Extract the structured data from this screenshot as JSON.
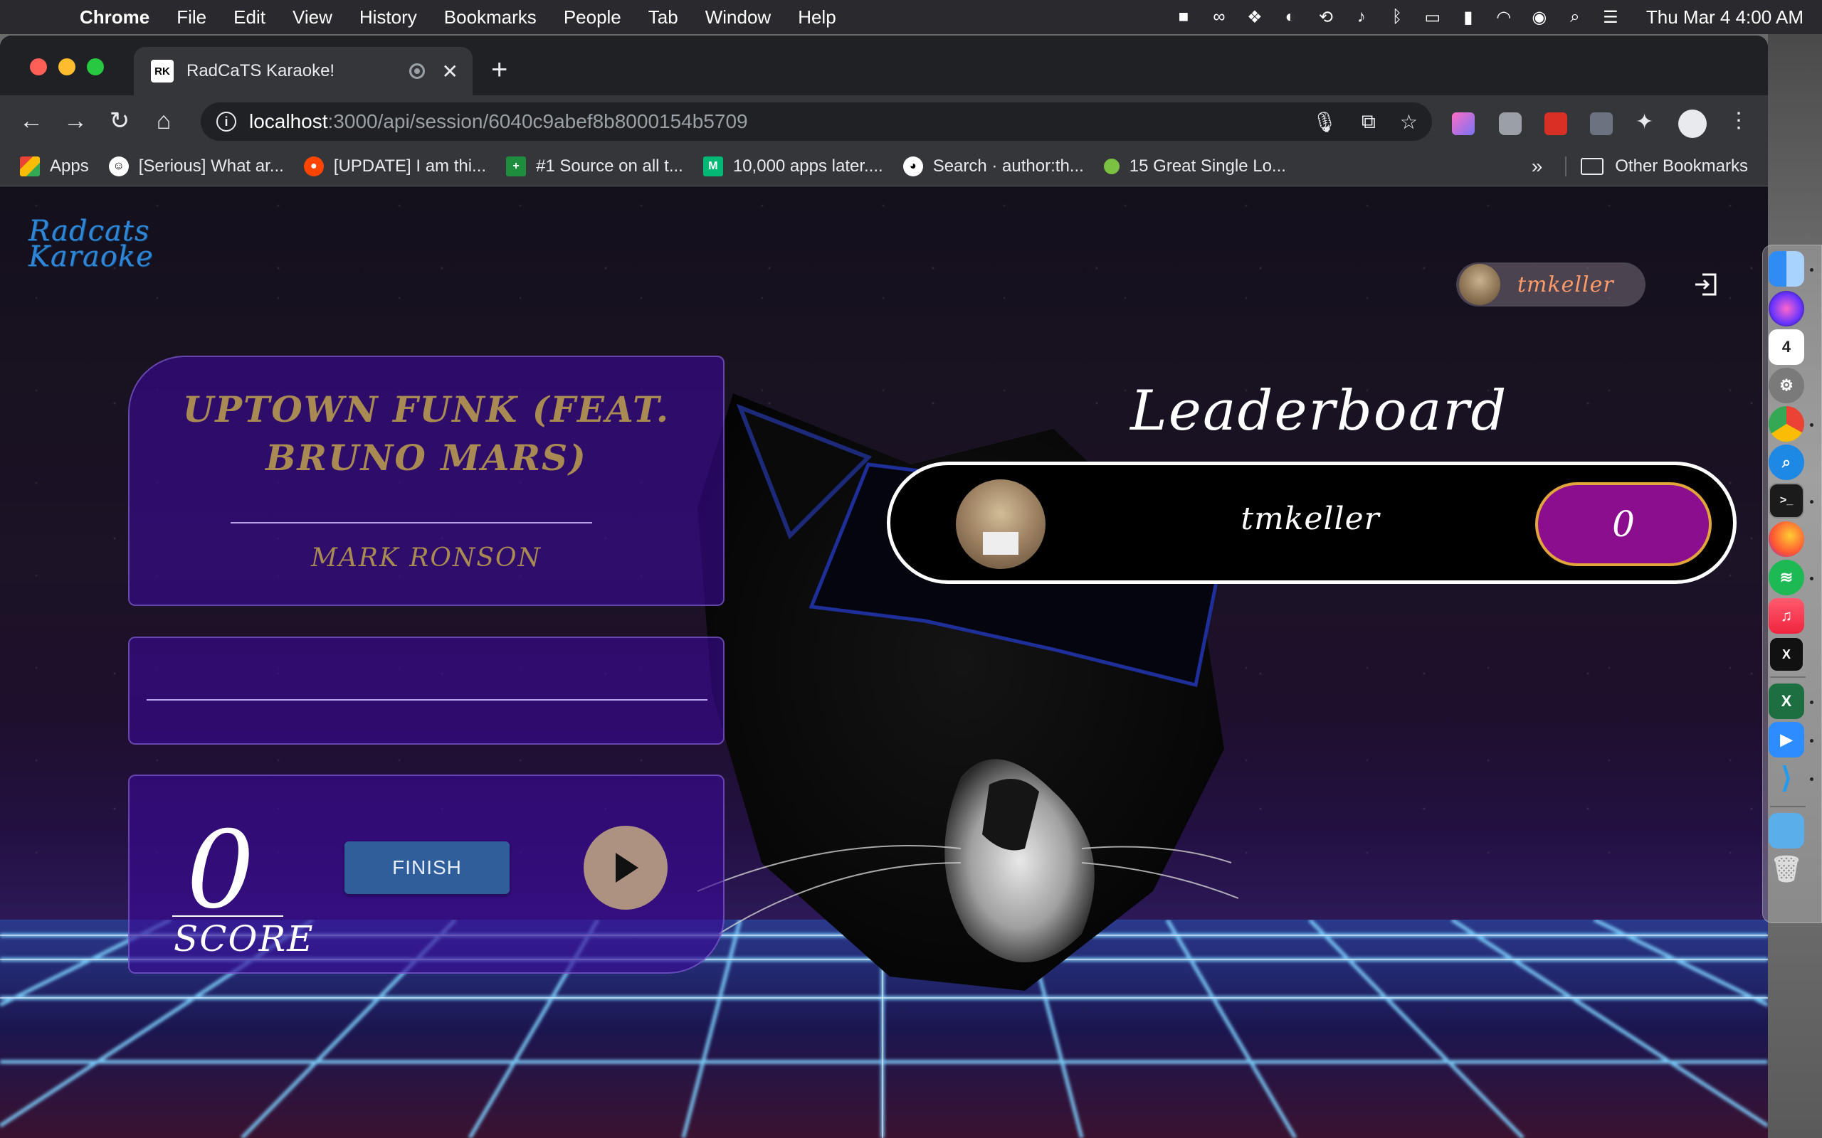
{
  "menubar": {
    "app": "Chrome",
    "items": [
      "File",
      "Edit",
      "View",
      "History",
      "Bookmarks",
      "People",
      "Tab",
      "Window",
      "Help"
    ],
    "clock": "Thu Mar 4  4:00 AM"
  },
  "browser": {
    "tab_title": "RadCaTS Karaoke!",
    "favicon_text": "RK",
    "url_host": "localhost",
    "url_path": ":3000/api/session/6040c9abef8b8000154b5709",
    "bookmarks": [
      {
        "label": "Apps",
        "icon": "apps-grid-icon",
        "color": "#ea4335"
      },
      {
        "label": "[Serious] What ar...",
        "icon": "reddit-alien-icon",
        "color": "#ffffff"
      },
      {
        "label": "[UPDATE] I am thi...",
        "icon": "reddit-icon",
        "color": "#ff4500"
      },
      {
        "label": "#1 Source on all t...",
        "icon": "plus-tile-icon",
        "color": "#1e8e3e"
      },
      {
        "label": "10,000 apps later....",
        "icon": "medium-icon",
        "color": "#02b875"
      },
      {
        "label": "Search · author:th...",
        "icon": "github-icon",
        "color": "#ffffff"
      },
      {
        "label": "15 Great Single Lo...",
        "icon": "green-dot-icon",
        "color": "#7cc242"
      }
    ],
    "overflow": "»",
    "other_bookmarks": "Other Bookmarks"
  },
  "app": {
    "logo_line1": "Radcats",
    "logo_line2": "Karaoke",
    "user_name": "tmkeller",
    "song": {
      "title": "UPTOWN FUNK (FEAT. BRUNO MARS)",
      "artist": "MARK RONSON"
    },
    "lyrics": "",
    "score": "0",
    "score_label": "SCORE",
    "finish_label": "FINISH",
    "leaderboard": {
      "title": "Leaderboard",
      "entries": [
        {
          "name": "tmkeller",
          "score": "0"
        }
      ]
    },
    "colors": {
      "accent_gold": "#a88a52",
      "panel_purple": "#3a0a96",
      "score_pill": "#8a0e8e",
      "finish_blue": "#2f5e9b",
      "username_orange": "#ff9b6a"
    }
  }
}
